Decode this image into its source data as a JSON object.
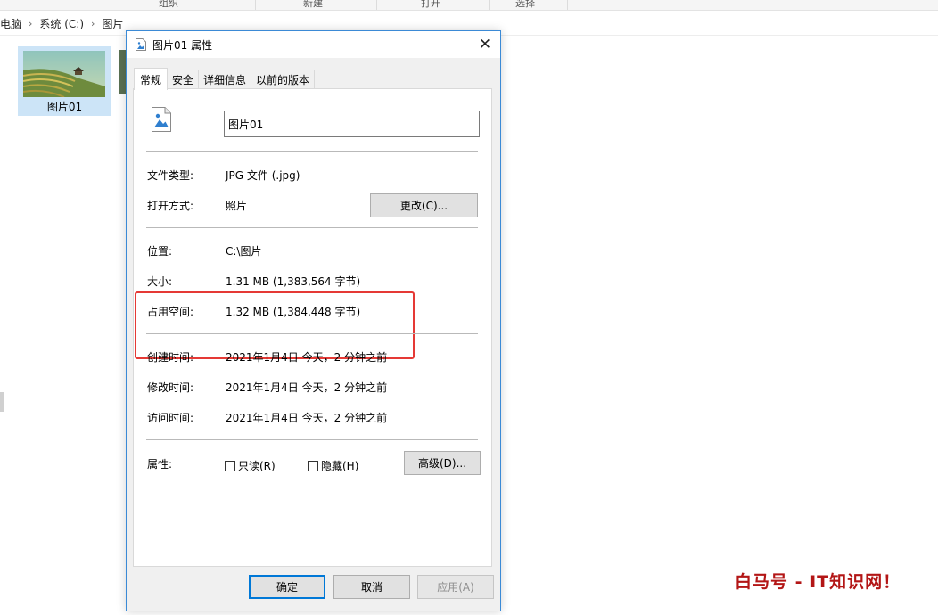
{
  "explorer": {
    "ribbon_groups": [
      "组织",
      "新建",
      "打开",
      "选择"
    ],
    "breadcrumb": [
      "电脑",
      "系统 (C:)",
      "图片"
    ],
    "file_name": "图片01"
  },
  "dialog": {
    "title": "图片01 属性",
    "close_glyph": "✕",
    "tabs": [
      "常规",
      "安全",
      "详细信息",
      "以前的版本"
    ],
    "name_value": "图片01",
    "rows": [
      {
        "label": "文件类型:",
        "value": "JPG 文件 (.jpg)"
      },
      {
        "label": "打开方式:",
        "value": "照片"
      },
      {
        "label": "位置:",
        "value": "C:\\图片"
      },
      {
        "label": "大小:",
        "value": "1.31 MB (1,383,564 字节)"
      },
      {
        "label": "占用空间:",
        "value": "1.32 MB (1,384,448 字节)"
      },
      {
        "label": "创建时间:",
        "value": "2021年1月4日 今天，2 分钟之前"
      },
      {
        "label": "修改时间:",
        "value": "2021年1月4日 今天，2 分钟之前"
      },
      {
        "label": "访问时间:",
        "value": "2021年1月4日 今天，2 分钟之前"
      }
    ],
    "change_button": "更改(C)...",
    "attributes_label": "属性:",
    "readonly_label": "只读(R)",
    "hidden_label": "隐藏(H)",
    "advanced_button": "高级(D)...",
    "ok_button": "确定",
    "cancel_button": "取消",
    "apply_button": "应用(A)"
  },
  "watermark": "白马号 - IT知识网！",
  "colors": {
    "dialog_border": "#3b8ad6",
    "highlight_box": "#e53935",
    "selection": "#cce4f7",
    "watermark": "#b31616"
  }
}
